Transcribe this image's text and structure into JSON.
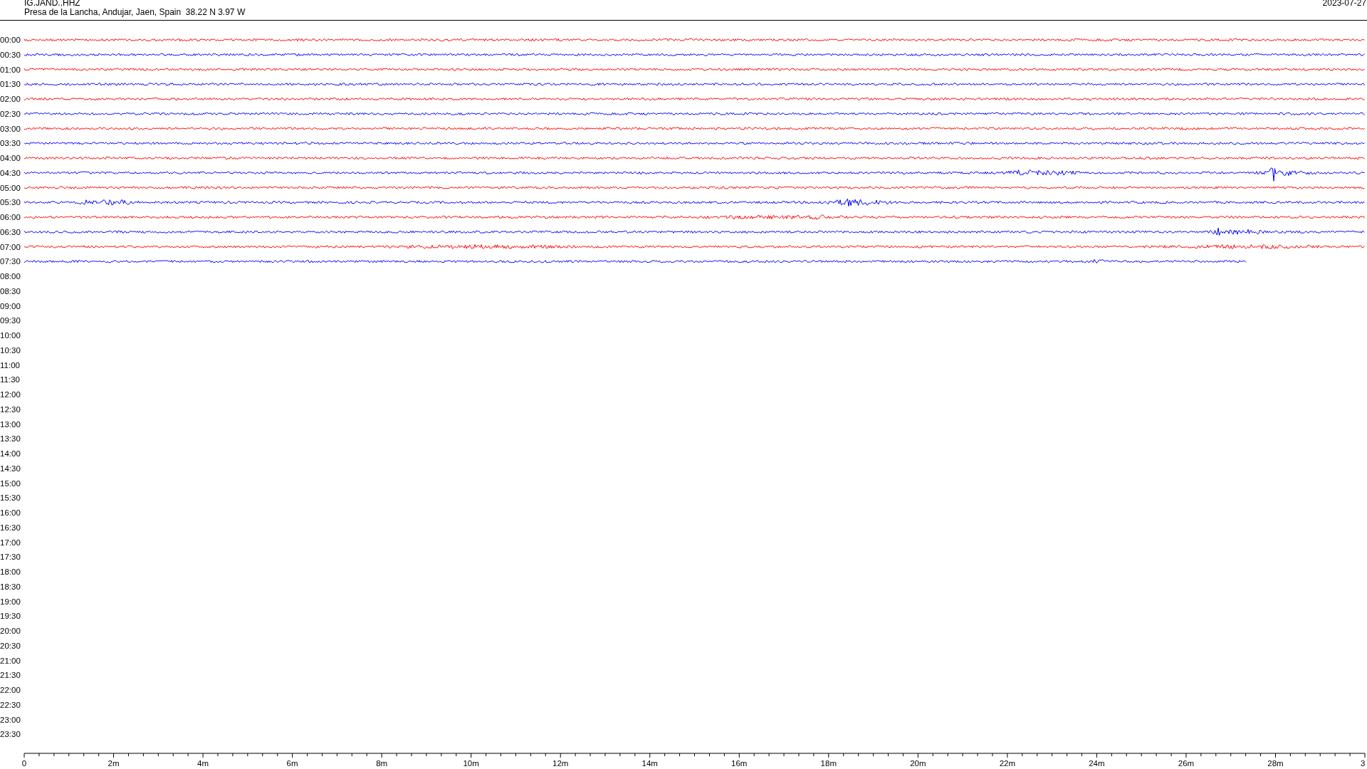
{
  "header": {
    "station": "IG.JAND..HHZ",
    "location": "Presa de la Lancha, Andujar, Jaen, Spain  38.22 N 3.97 W",
    "date": "2023-07-27"
  },
  "time_labels": [
    "00:00",
    "00:30",
    "01:00",
    "01:30",
    "02:00",
    "02:30",
    "03:00",
    "03:30",
    "04:00",
    "04:30",
    "05:00",
    "05:30",
    "06:00",
    "06:30",
    "07:00",
    "07:30",
    "08:00",
    "08:30",
    "09:00",
    "09:30",
    "10:00",
    "10:30",
    "11:00",
    "11:30",
    "12:00",
    "12:30",
    "13:00",
    "13:30",
    "14:00",
    "14:30",
    "15:00",
    "15:30",
    "16:00",
    "16:30",
    "17:00",
    "17:30",
    "18:00",
    "18:30",
    "19:00",
    "19:30",
    "20:00",
    "20:30",
    "21:00",
    "21:30",
    "22:00",
    "22:30",
    "23:00",
    "23:30"
  ],
  "traces": [
    {
      "color": "#ff0000"
    },
    {
      "color": "#0000ff"
    },
    {
      "color": "#ff0000"
    },
    {
      "color": "#0000ff"
    },
    {
      "color": "#ff0000"
    },
    {
      "color": "#0000ff"
    },
    {
      "color": "#ff0000"
    },
    {
      "color": "#0000ff"
    },
    {
      "color": "#ff0000"
    },
    {
      "color": "#0000ff"
    },
    {
      "color": "#ff0000"
    },
    {
      "color": "#0000ff"
    },
    {
      "color": "#ff0000"
    },
    {
      "color": "#0000ff"
    },
    {
      "color": "#ff0000"
    },
    {
      "color": "#0000ff"
    }
  ],
  "x_axis": {
    "tick_labels": [
      "0",
      "2m",
      "4m",
      "6m",
      "8m",
      "10m",
      "12m",
      "14m",
      "16m",
      "18m",
      "20m",
      "22m",
      "24m",
      "26m",
      "28m",
      "3"
    ]
  }
}
